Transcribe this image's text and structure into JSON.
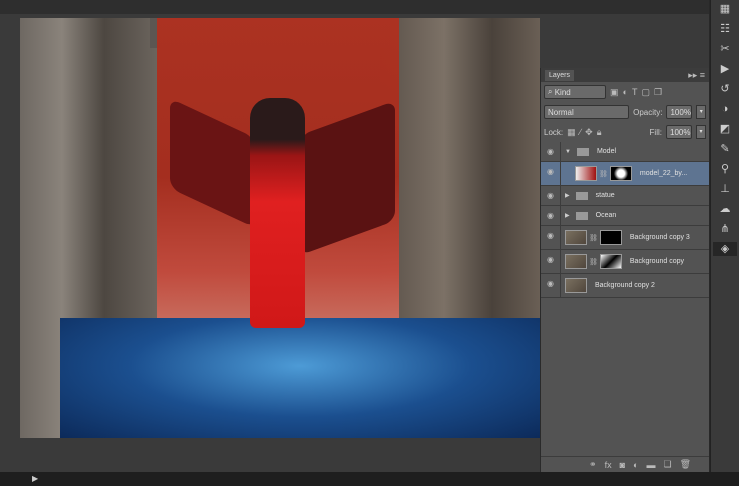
{
  "layers_panel": {
    "tab_label": "Layers",
    "filter_kind": "Kind",
    "blend_mode": "Normal",
    "opacity_label": "Opacity:",
    "opacity_value": "100%",
    "lock_label": "Lock:",
    "fill_label": "Fill:",
    "fill_value": "100%",
    "layers": [
      {
        "name": "Model",
        "type": "group",
        "expanded": true
      },
      {
        "name": "model_22_by...",
        "type": "layer-with-mask",
        "selected": true
      },
      {
        "name": "statue",
        "type": "group",
        "expanded": false
      },
      {
        "name": "Ocean",
        "type": "group",
        "expanded": false
      },
      {
        "name": "Background copy 3",
        "type": "layer-with-mask"
      },
      {
        "name": "Background copy",
        "type": "layer-with-mask"
      },
      {
        "name": "Background copy 2",
        "type": "layer"
      }
    ],
    "footer_icons": [
      "link-icon",
      "fx-icon",
      "mask-icon",
      "adjustment-icon",
      "folder-icon",
      "new-layer-icon",
      "trash-icon"
    ]
  },
  "colors": {
    "selection": "#5e7491",
    "panel": "#535353"
  }
}
